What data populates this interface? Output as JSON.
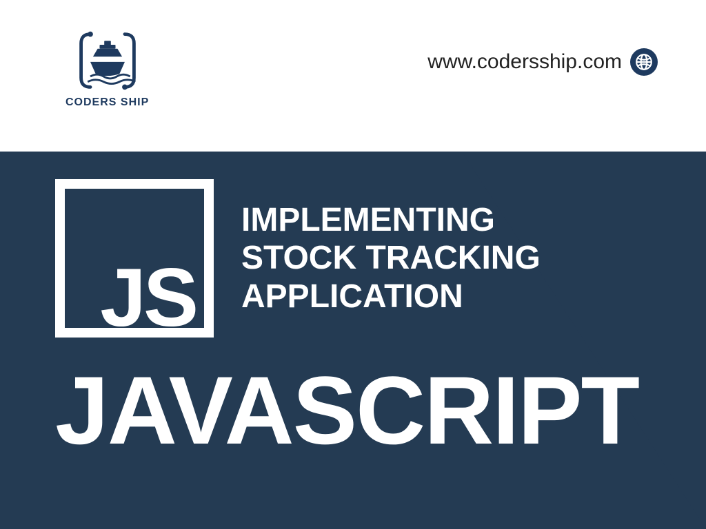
{
  "brand": {
    "name": "CODERS SHIP"
  },
  "site_url": "www.codersship.com",
  "badge_text": "JS",
  "topic": {
    "line1": "IMPLEMENTING",
    "line2": "STOCK TRACKING",
    "line3": "APPLICATION"
  },
  "language": "JAVASCRIPT",
  "colors": {
    "brand_navy": "#1e3a5f",
    "banner_navy": "#243b53",
    "text_white": "#ffffff"
  }
}
